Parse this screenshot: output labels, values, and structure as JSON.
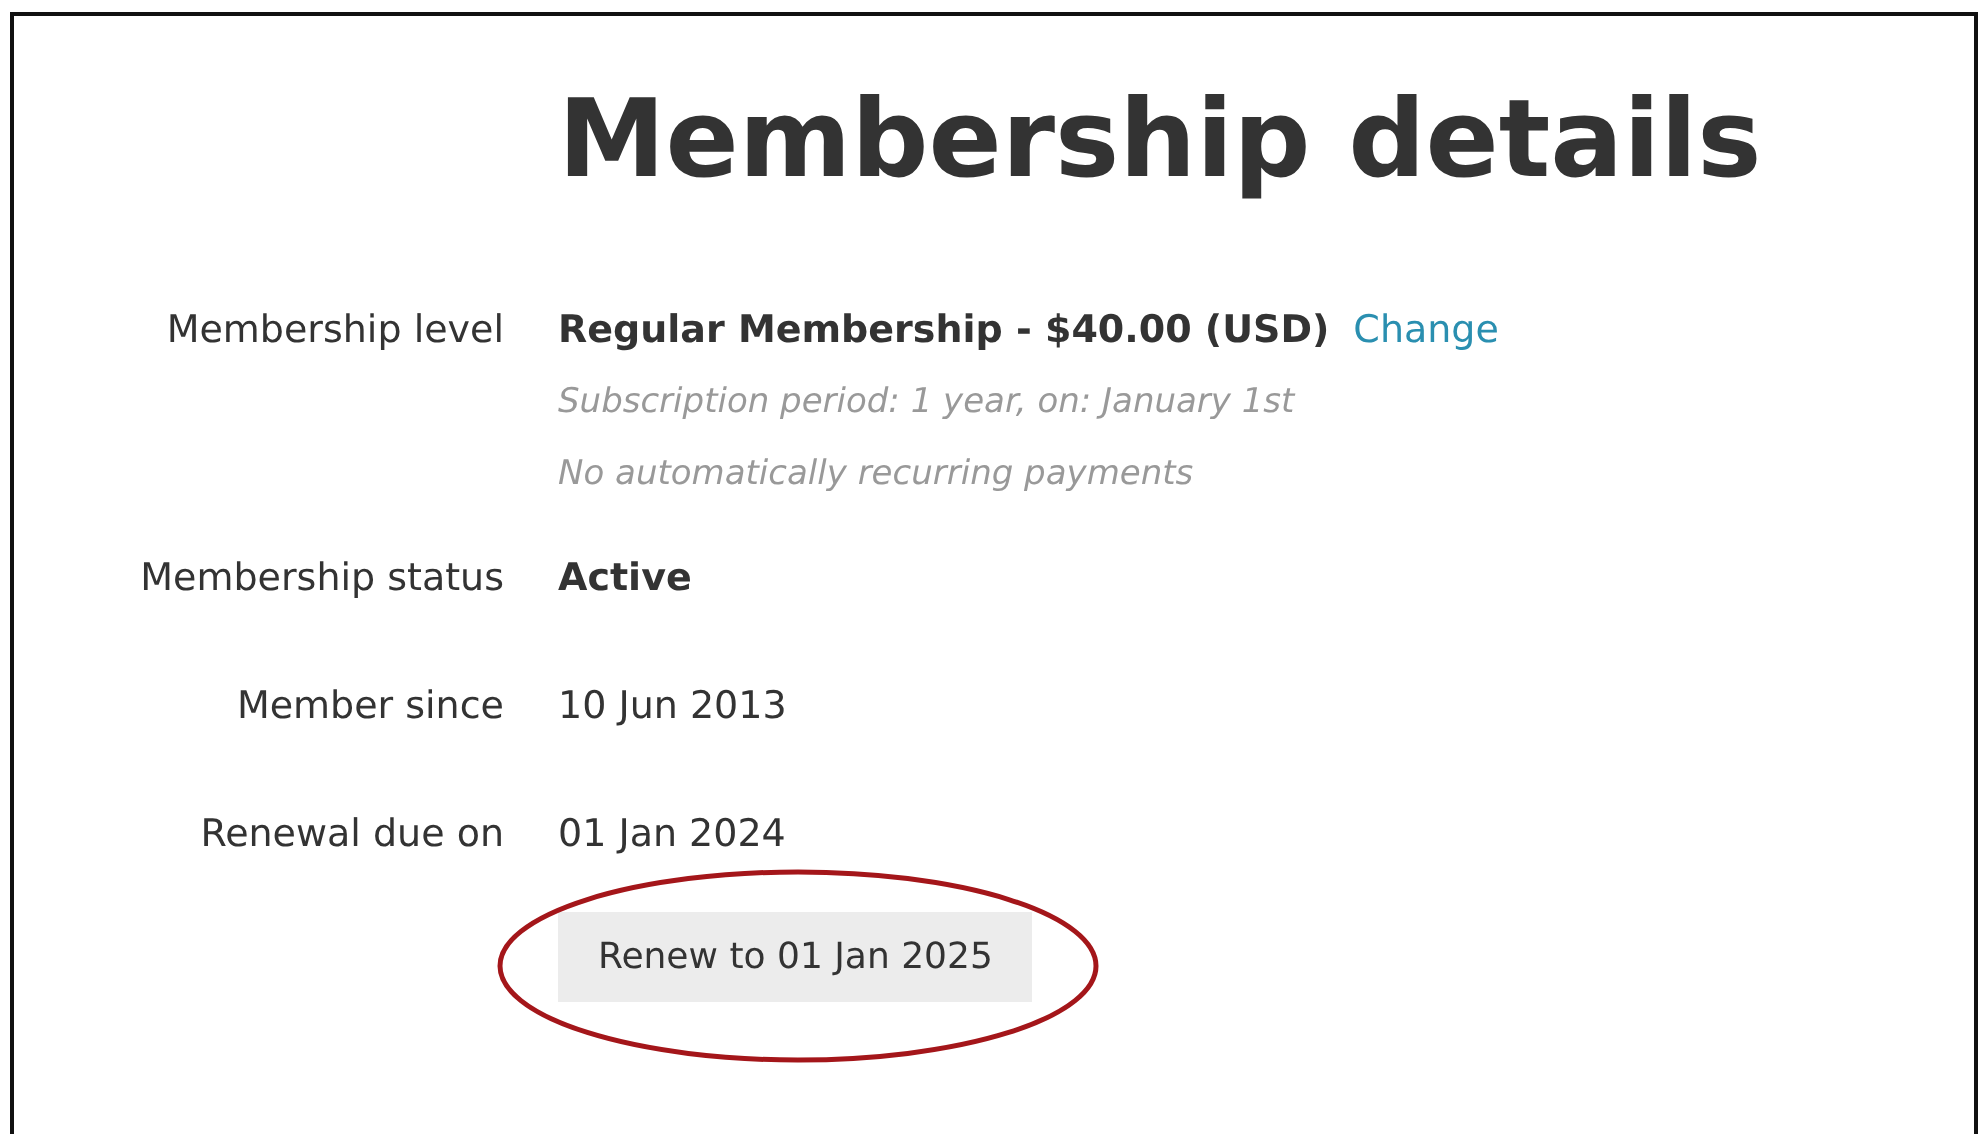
{
  "title": "Membership details",
  "rows": [
    {
      "kind": "level",
      "label": "Membership level",
      "value": "Regular Membership - $40.00 (USD)",
      "link": "Change",
      "notes": [
        "Subscription period: 1 year, on: January 1st",
        "No automatically recurring payments"
      ]
    },
    {
      "kind": "strong",
      "label": "Membership status",
      "value": "Active"
    },
    {
      "kind": "plain",
      "label": "Member since",
      "value": "10 Jun 2013"
    },
    {
      "kind": "plain",
      "label": "Renewal due on",
      "value": "01 Jan 2024"
    }
  ],
  "renew_button": {
    "label": "Renew to 01 Jan 2025",
    "circled": true
  }
}
